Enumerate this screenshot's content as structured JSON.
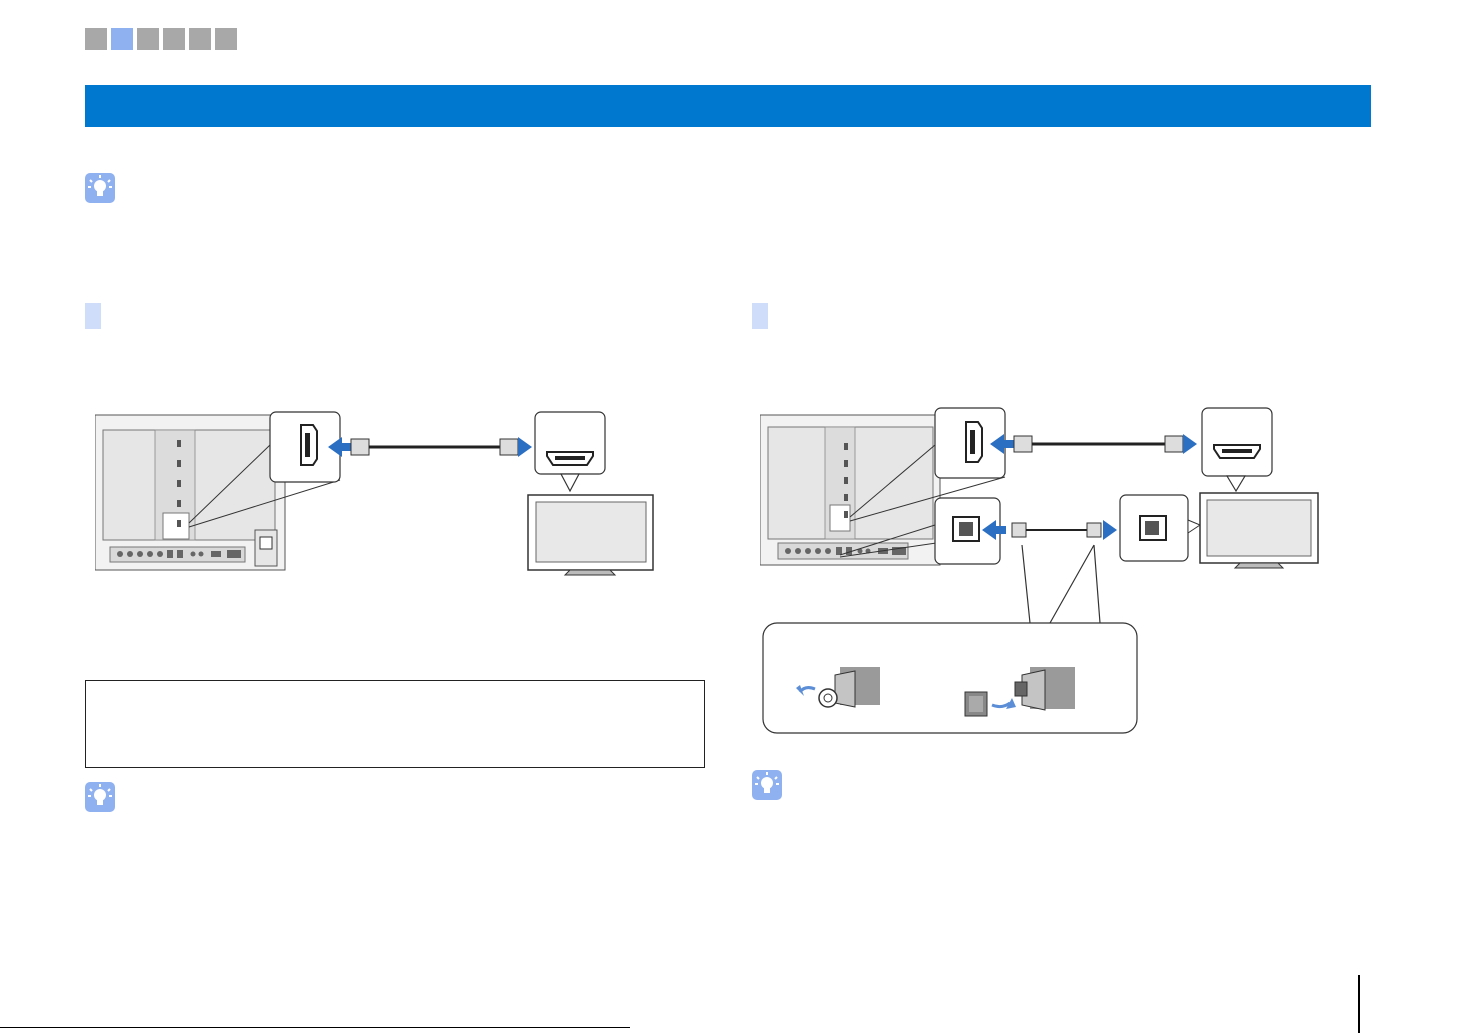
{
  "chapter_indicator": {
    "squares": 6,
    "active_index": 1,
    "color_inactive": "#a8a8a8",
    "color_active": "#8fb1ef"
  },
  "header": {
    "band_color": "#0078d0"
  },
  "icons": {
    "hint": "lightbulb-hint-icon"
  },
  "colors": {
    "accent_blue": "#0078d0",
    "arrow_blue": "#2b6fc3",
    "section_marker": "#cfdcfa"
  }
}
